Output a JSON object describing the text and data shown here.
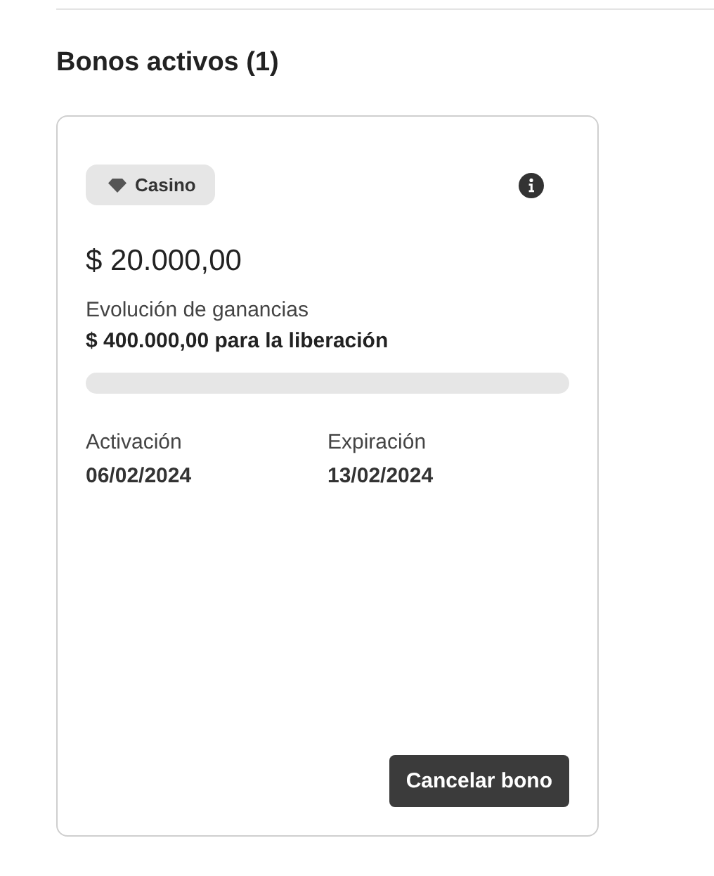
{
  "section_title": "Bonos activos (1)",
  "bonus": {
    "category": "Casino",
    "amount": "$ 20.000,00",
    "progress_label": "Evolución de ganancias",
    "release_text": "$ 400.000,00 para la liberación",
    "level": 0,
    "dates": [
      {
        "label": "Activación",
        "value": "06/02/2024"
      },
      {
        "label": "Expiración",
        "value": "13/02/2024"
      }
    ],
    "button": "Cancelar bono"
  }
}
